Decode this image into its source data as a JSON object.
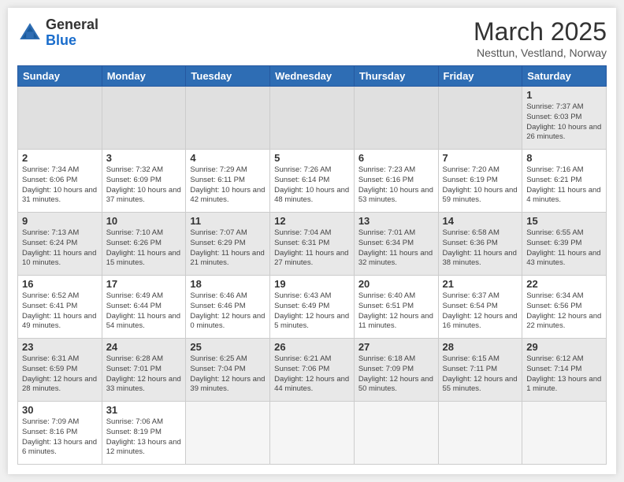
{
  "header": {
    "logo_general": "General",
    "logo_blue": "Blue",
    "month_title": "March 2025",
    "subtitle": "Nesttun, Vestland, Norway"
  },
  "weekdays": [
    "Sunday",
    "Monday",
    "Tuesday",
    "Wednesday",
    "Thursday",
    "Friday",
    "Saturday"
  ],
  "weeks": [
    [
      {
        "day": "",
        "info": "",
        "empty": true
      },
      {
        "day": "",
        "info": "",
        "empty": true
      },
      {
        "day": "",
        "info": "",
        "empty": true
      },
      {
        "day": "",
        "info": "",
        "empty": true
      },
      {
        "day": "",
        "info": "",
        "empty": true
      },
      {
        "day": "",
        "info": "",
        "empty": true
      },
      {
        "day": "1",
        "info": "Sunrise: 7:37 AM\nSunset: 6:03 PM\nDaylight: 10 hours and 26 minutes."
      }
    ],
    [
      {
        "day": "2",
        "info": "Sunrise: 7:34 AM\nSunset: 6:06 PM\nDaylight: 10 hours and 31 minutes."
      },
      {
        "day": "3",
        "info": "Sunrise: 7:32 AM\nSunset: 6:09 PM\nDaylight: 10 hours and 37 minutes."
      },
      {
        "day": "4",
        "info": "Sunrise: 7:29 AM\nSunset: 6:11 PM\nDaylight: 10 hours and 42 minutes."
      },
      {
        "day": "5",
        "info": "Sunrise: 7:26 AM\nSunset: 6:14 PM\nDaylight: 10 hours and 48 minutes."
      },
      {
        "day": "6",
        "info": "Sunrise: 7:23 AM\nSunset: 6:16 PM\nDaylight: 10 hours and 53 minutes."
      },
      {
        "day": "7",
        "info": "Sunrise: 7:20 AM\nSunset: 6:19 PM\nDaylight: 10 hours and 59 minutes."
      },
      {
        "day": "8",
        "info": "Sunrise: 7:16 AM\nSunset: 6:21 PM\nDaylight: 11 hours and 4 minutes."
      }
    ],
    [
      {
        "day": "9",
        "info": "Sunrise: 7:13 AM\nSunset: 6:24 PM\nDaylight: 11 hours and 10 minutes."
      },
      {
        "day": "10",
        "info": "Sunrise: 7:10 AM\nSunset: 6:26 PM\nDaylight: 11 hours and 15 minutes."
      },
      {
        "day": "11",
        "info": "Sunrise: 7:07 AM\nSunset: 6:29 PM\nDaylight: 11 hours and 21 minutes."
      },
      {
        "day": "12",
        "info": "Sunrise: 7:04 AM\nSunset: 6:31 PM\nDaylight: 11 hours and 27 minutes."
      },
      {
        "day": "13",
        "info": "Sunrise: 7:01 AM\nSunset: 6:34 PM\nDaylight: 11 hours and 32 minutes."
      },
      {
        "day": "14",
        "info": "Sunrise: 6:58 AM\nSunset: 6:36 PM\nDaylight: 11 hours and 38 minutes."
      },
      {
        "day": "15",
        "info": "Sunrise: 6:55 AM\nSunset: 6:39 PM\nDaylight: 11 hours and 43 minutes."
      }
    ],
    [
      {
        "day": "16",
        "info": "Sunrise: 6:52 AM\nSunset: 6:41 PM\nDaylight: 11 hours and 49 minutes."
      },
      {
        "day": "17",
        "info": "Sunrise: 6:49 AM\nSunset: 6:44 PM\nDaylight: 11 hours and 54 minutes."
      },
      {
        "day": "18",
        "info": "Sunrise: 6:46 AM\nSunset: 6:46 PM\nDaylight: 12 hours and 0 minutes."
      },
      {
        "day": "19",
        "info": "Sunrise: 6:43 AM\nSunset: 6:49 PM\nDaylight: 12 hours and 5 minutes."
      },
      {
        "day": "20",
        "info": "Sunrise: 6:40 AM\nSunset: 6:51 PM\nDaylight: 12 hours and 11 minutes."
      },
      {
        "day": "21",
        "info": "Sunrise: 6:37 AM\nSunset: 6:54 PM\nDaylight: 12 hours and 16 minutes."
      },
      {
        "day": "22",
        "info": "Sunrise: 6:34 AM\nSunset: 6:56 PM\nDaylight: 12 hours and 22 minutes."
      }
    ],
    [
      {
        "day": "23",
        "info": "Sunrise: 6:31 AM\nSunset: 6:59 PM\nDaylight: 12 hours and 28 minutes."
      },
      {
        "day": "24",
        "info": "Sunrise: 6:28 AM\nSunset: 7:01 PM\nDaylight: 12 hours and 33 minutes."
      },
      {
        "day": "25",
        "info": "Sunrise: 6:25 AM\nSunset: 7:04 PM\nDaylight: 12 hours and 39 minutes."
      },
      {
        "day": "26",
        "info": "Sunrise: 6:21 AM\nSunset: 7:06 PM\nDaylight: 12 hours and 44 minutes."
      },
      {
        "day": "27",
        "info": "Sunrise: 6:18 AM\nSunset: 7:09 PM\nDaylight: 12 hours and 50 minutes."
      },
      {
        "day": "28",
        "info": "Sunrise: 6:15 AM\nSunset: 7:11 PM\nDaylight: 12 hours and 55 minutes."
      },
      {
        "day": "29",
        "info": "Sunrise: 6:12 AM\nSunset: 7:14 PM\nDaylight: 13 hours and 1 minute."
      }
    ],
    [
      {
        "day": "30",
        "info": "Sunrise: 7:09 AM\nSunset: 8:16 PM\nDaylight: 13 hours and 6 minutes."
      },
      {
        "day": "31",
        "info": "Sunrise: 7:06 AM\nSunset: 8:19 PM\nDaylight: 13 hours and 12 minutes."
      },
      {
        "day": "",
        "info": "",
        "empty": true
      },
      {
        "day": "",
        "info": "",
        "empty": true
      },
      {
        "day": "",
        "info": "",
        "empty": true
      },
      {
        "day": "",
        "info": "",
        "empty": true
      },
      {
        "day": "",
        "info": "",
        "empty": true
      }
    ]
  ]
}
